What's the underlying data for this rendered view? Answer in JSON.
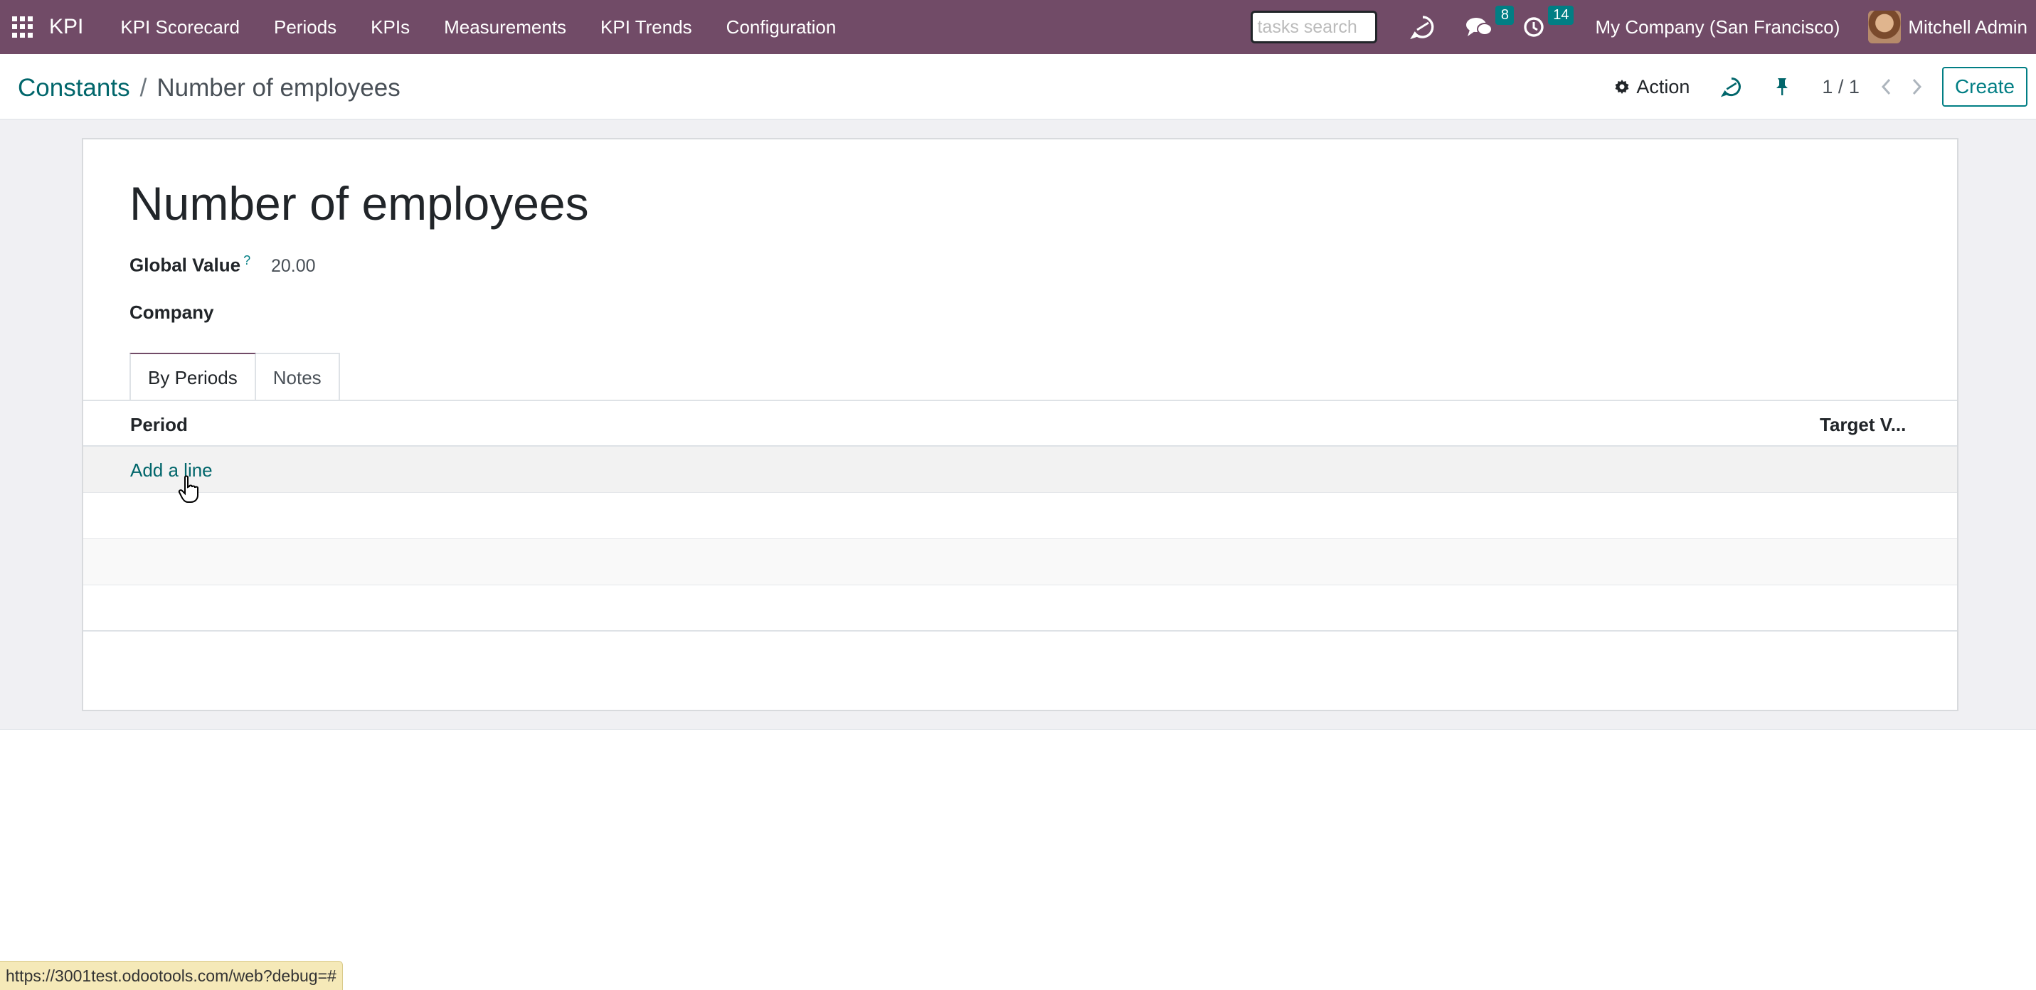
{
  "navbar": {
    "brand": "KPI",
    "menu": [
      "KPI Scorecard",
      "Periods",
      "KPIs",
      "Measurements",
      "KPI Trends",
      "Configuration"
    ],
    "search_placeholder": "tasks search",
    "messages_count": "8",
    "activities_count": "14",
    "company": "My Company (San Francisco)",
    "user": "Mitchell Admin",
    "bg_color": "#714b67"
  },
  "control_panel": {
    "breadcrumb_parent": "Constants",
    "breadcrumb_separator": "/",
    "breadcrumb_current": "Number of employees",
    "action_label": "Action",
    "pager": "1 / 1",
    "create_label": "Create"
  },
  "form": {
    "title": "Number of employees",
    "global_value_label": "Global Value",
    "help_mark": "?",
    "global_value": "20.00",
    "company_label": "Company",
    "tabs": [
      "By Periods",
      "Notes"
    ],
    "columns": [
      "Period",
      "Target V..."
    ],
    "add_line": "Add a line"
  },
  "status_bar": {
    "url": "https://3001test.odootools.com/web?debug=#"
  },
  "icons": {
    "apps": "apps-grid-icon",
    "discuss": "discuss-icon",
    "messages": "chat-bubbles-icon",
    "activities": "clock-icon",
    "action": "gear-icon",
    "refresh": "refresh-icon",
    "pin": "pin-icon",
    "prev": "chevron-left-icon",
    "next": "chevron-right-icon"
  },
  "colors": {
    "accent": "#017e84",
    "link": "#01666b"
  }
}
